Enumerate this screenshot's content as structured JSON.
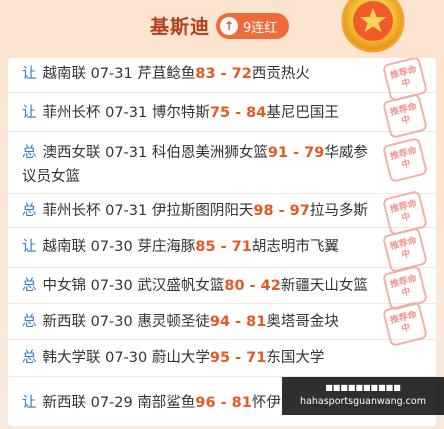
{
  "header": {
    "name": "基斯迪",
    "streak_label": "9连红",
    "streak_icon": "arrow-up-icon",
    "medal_icon": "star-medal-icon"
  },
  "stamp_text": "推荐命中",
  "rows": [
    {
      "type": "让",
      "league": "越南联",
      "date": "07-31",
      "home": "芹苴鲶鱼",
      "home_score": "83",
      "away_score": "72",
      "away": "西贡热火"
    },
    {
      "type": "让",
      "league": "菲州长杯",
      "date": "07-31",
      "home": "博尔特斯",
      "home_score": "75",
      "away_score": "84",
      "away": "基尼巴国王"
    },
    {
      "type": "总",
      "league": "澳西女联",
      "date": "07-31",
      "home": "科伯恩美洲狮女篮",
      "home_score": "91",
      "away_score": "79",
      "away": "华威参议员女篮"
    },
    {
      "type": "总",
      "league": "菲州长杯",
      "date": "07-31",
      "home": "伊拉斯图阴阳天",
      "home_score": "98",
      "away_score": "97",
      "away": "拉马多斯"
    },
    {
      "type": "让",
      "league": "越南联",
      "date": "07-30",
      "home": "芽庄海豚",
      "home_score": "85",
      "away_score": "71",
      "away": "胡志明市飞翼"
    },
    {
      "type": "总",
      "league": "中女锦",
      "date": "07-30",
      "home": "武汉盛帆女篮",
      "home_score": "80",
      "away_score": "42",
      "away": "新疆天山女篮"
    },
    {
      "type": "总",
      "league": "新西联",
      "date": "07-30",
      "home": "惠灵顿圣徒",
      "home_score": "94",
      "away_score": "81",
      "away": "奥塔哥金块"
    },
    {
      "type": "总",
      "league": "韩大学联",
      "date": "07-30",
      "home": "蔚山大学",
      "home_score": "95",
      "away_score": "71",
      "away": "东国大学"
    },
    {
      "type": "让",
      "league": "新西联",
      "date": "07-29",
      "home": "南部鲨鱼",
      "home_score": "96",
      "away_score": "81",
      "away": "怀伊"
    }
  ],
  "watermark": {
    "top": "■■■■■■■■■■",
    "bottom": "hahasportsguanwang.com"
  }
}
